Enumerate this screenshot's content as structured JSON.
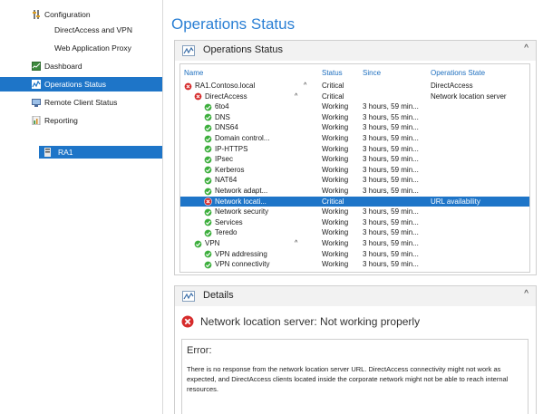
{
  "nav": {
    "configuration": "Configuration",
    "directaccess_vpn": "DirectAccess and VPN",
    "web_app_proxy": "Web Application Proxy",
    "dashboard": "Dashboard",
    "operations_status": "Operations Status",
    "remote_client_status": "Remote Client Status",
    "reporting": "Reporting",
    "server": "RA1"
  },
  "page_title": "Operations Status",
  "ops_panel": {
    "title": "Operations Status",
    "collapse_glyph": "^",
    "columns": {
      "name": "Name",
      "status": "Status",
      "since": "Since",
      "state": "Operations State"
    },
    "rows": [
      {
        "name": "RA1.Contoso.local",
        "status": "Critical",
        "since": "",
        "state": "DirectAccess",
        "icon": "error",
        "chevron": "^"
      },
      {
        "name": "DirectAccess",
        "status": "Critical",
        "since": "",
        "state": "Network location server",
        "icon": "error",
        "chevron": "^"
      },
      {
        "name": "6to4",
        "status": "Working",
        "since": "3 hours, 59 min...",
        "state": "",
        "icon": "ok"
      },
      {
        "name": "DNS",
        "status": "Working",
        "since": "3 hours, 55 min...",
        "state": "",
        "icon": "ok"
      },
      {
        "name": "DNS64",
        "status": "Working",
        "since": "3 hours, 59 min...",
        "state": "",
        "icon": "ok"
      },
      {
        "name": "Domain control...",
        "status": "Working",
        "since": "3 hours, 59 min...",
        "state": "",
        "icon": "ok"
      },
      {
        "name": "IP-HTTPS",
        "status": "Working",
        "since": "3 hours, 59 min...",
        "state": "",
        "icon": "ok"
      },
      {
        "name": "IPsec",
        "status": "Working",
        "since": "3 hours, 59 min...",
        "state": "",
        "icon": "ok"
      },
      {
        "name": "Kerberos",
        "status": "Working",
        "since": "3 hours, 59 min...",
        "state": "",
        "icon": "ok"
      },
      {
        "name": "NAT64",
        "status": "Working",
        "since": "3 hours, 59 min...",
        "state": "",
        "icon": "ok"
      },
      {
        "name": "Network adapt...",
        "status": "Working",
        "since": "3 hours, 59 min...",
        "state": "",
        "icon": "ok"
      },
      {
        "name": "Network locati...",
        "status": "Critical",
        "since": "",
        "state": "URL availability",
        "icon": "error",
        "selected": true
      },
      {
        "name": "Network security",
        "status": "Working",
        "since": "3 hours, 59 min...",
        "state": "",
        "icon": "ok"
      },
      {
        "name": "Services",
        "status": "Working",
        "since": "3 hours, 59 min...",
        "state": "",
        "icon": "ok"
      },
      {
        "name": "Teredo",
        "status": "Working",
        "since": "3 hours, 59 min...",
        "state": "",
        "icon": "ok"
      },
      {
        "name": "VPN",
        "status": "Working",
        "since": "3 hours, 59 min...",
        "state": "",
        "icon": "ok",
        "chevron": "^"
      },
      {
        "name": "VPN addressing",
        "status": "Working",
        "since": "3 hours, 59 min...",
        "state": "",
        "icon": "ok"
      },
      {
        "name": "VPN connectivity",
        "status": "Working",
        "since": "3 hours, 59 min...",
        "state": "",
        "icon": "ok"
      }
    ]
  },
  "details_panel": {
    "title": "Details",
    "collapse_glyph": "^",
    "heading": "Network location server: Not working properly",
    "error_title": "Error:",
    "error_text": "There is no response from the network location server URL. DirectAccess connectivity might not work as expected, and DirectAccess clients located inside the corporate network might not be able to reach internal resources."
  },
  "colors": {
    "accent": "#1e75c8",
    "title_blue": "#2a7fd4",
    "ok_green": "#3cae3c",
    "error_red": "#d62b2b"
  }
}
